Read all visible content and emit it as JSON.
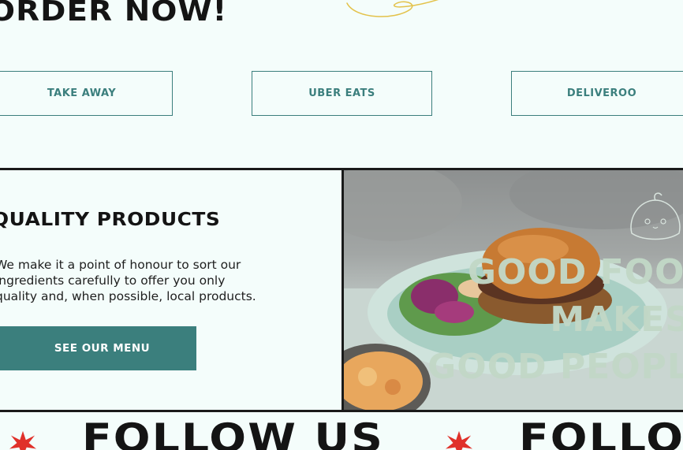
{
  "order": {
    "title": "ORDER NOW!",
    "buttons": {
      "takeaway": "TAKE AWAY",
      "uber": "UBER EATS",
      "deliveroo": "DELIVEROO"
    }
  },
  "quality": {
    "title": "QUALITY PRODUCTS",
    "text_lines": [
      "We make it a point of honour to sort our",
      "ingredients carefully to offer you only",
      "quality and, when possible, local products."
    ],
    "menu_button": "SEE OUR MENU"
  },
  "slogan": {
    "line1": "GOOD FOOD",
    "line2": "MAKES",
    "line3": "GOOD PEOPLE"
  },
  "follow": {
    "label": "FOLLOW US"
  },
  "colors": {
    "accent": "#3b7f7d",
    "background": "#f4fdfb",
    "ink": "#141414",
    "star": "#e0312a",
    "slogan": "#c2d8c7",
    "squiggle": "#e3c24a"
  },
  "icons": {
    "squiggle": "squiggle-decoration-icon",
    "dumpling": "dumpling-mascot-icon",
    "star": "star-burst-icon"
  }
}
